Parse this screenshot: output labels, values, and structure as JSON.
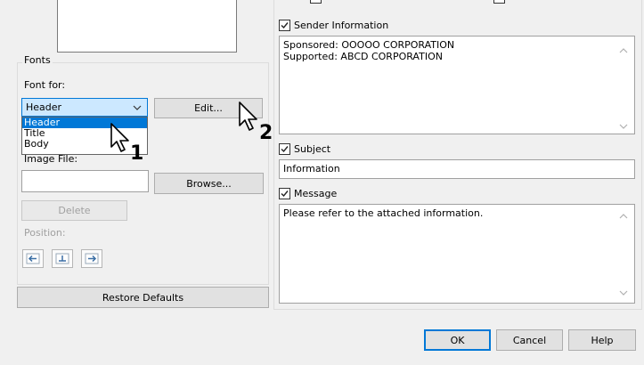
{
  "fonts_group": {
    "title": "Fonts",
    "font_for_label": "Font for:",
    "font_for_selected": "Header",
    "font_for_options": [
      "Header",
      "Title",
      "Body"
    ],
    "edit_button": "Edit..."
  },
  "image_group": {
    "image_file_label": "Image File:",
    "image_file_value": "",
    "browse_button": "Browse...",
    "delete_button": "Delete",
    "position_label": "Position:"
  },
  "restore_defaults_button": "Restore Defaults",
  "sender_information": {
    "label": "Sender Information",
    "checked": true,
    "text": "Sponsored: OOOOO CORPORATION\nSupported: ABCD CORPORATION"
  },
  "subject": {
    "label": "Subject",
    "checked": true,
    "value": "Information"
  },
  "message": {
    "label": "Message",
    "checked": true,
    "text": "Please refer to the attached information."
  },
  "footer": {
    "ok_button": "OK",
    "cancel_button": "Cancel",
    "help_button": "Help"
  },
  "callouts": {
    "step1": "1",
    "step2": "2"
  },
  "colors": {
    "accent": "#0078d7",
    "dialog_bg": "#f0f0f0",
    "selection": "#cce8ff"
  }
}
